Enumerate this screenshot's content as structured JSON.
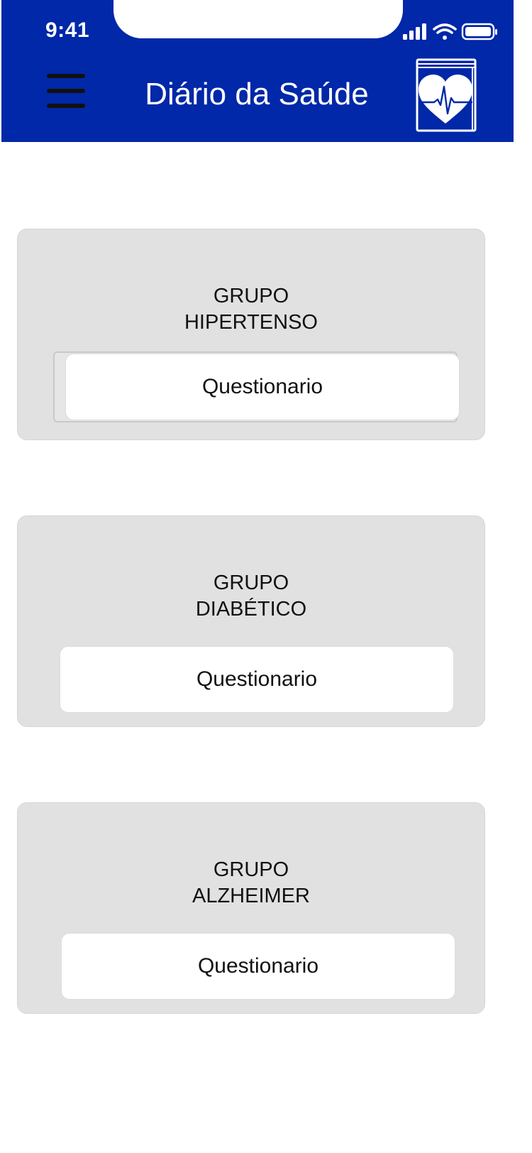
{
  "status_bar": {
    "time": "9:41",
    "icons": [
      "signal-icon",
      "wifi-icon",
      "battery-icon"
    ]
  },
  "header": {
    "title": "Diário da Saúde",
    "menu_icon": "hamburger-menu-icon",
    "logo_icon": "health-book-heart-icon",
    "background_color": "#0028A8"
  },
  "groups": [
    {
      "title_line1": "GRUPO",
      "title_line2": "HIPERTENSO",
      "button_label": "Questionario"
    },
    {
      "title_line1": "GRUPO",
      "title_line2": "DIABÉTICO",
      "button_label": "Questionario"
    },
    {
      "title_line1": "GRUPO",
      "title_line2": "ALZHEIMER",
      "button_label": "Questionario"
    }
  ],
  "colors": {
    "card_background": "#E1E1E1",
    "button_background": "#FFFFFF"
  }
}
